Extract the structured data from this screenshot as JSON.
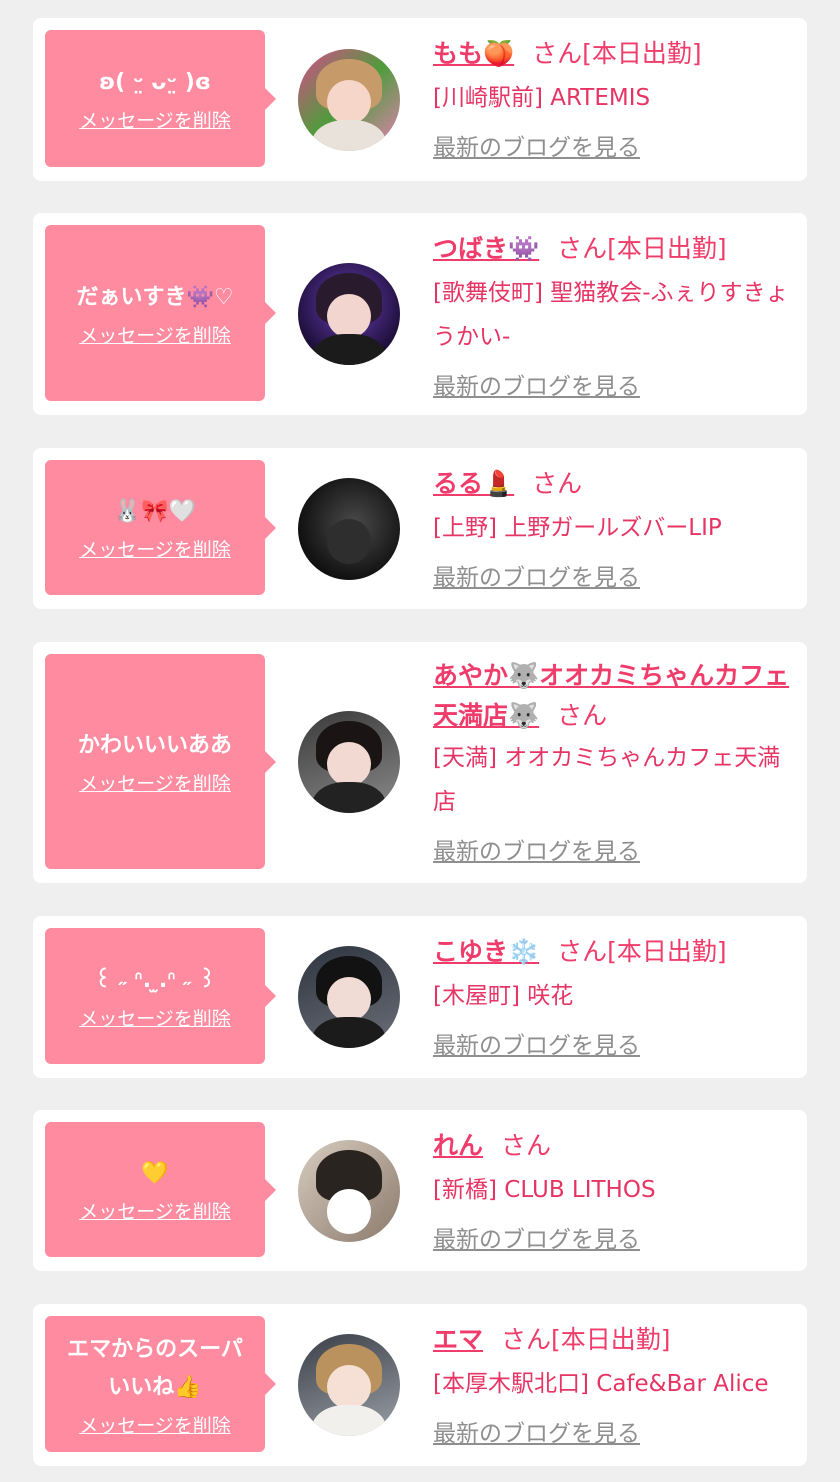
{
  "colors": {
    "accent": "#fe8ba0",
    "name": "#ef3c6b",
    "shop": "#e63565",
    "link_gray": "#8f8f8f",
    "page_bg": "#efefef"
  },
  "delete_label": "メッセージを削除",
  "blog_label": "最新のブログを見る",
  "items": [
    {
      "message": "ʚ(  ᵕ̤ ᴗᵕ̤ )ɞ",
      "name": "もも🍑",
      "suffix": "さん[本日出勤]",
      "shop": "[川崎駅前] ARTEMIS"
    },
    {
      "message": "だぁいすき👾♡",
      "name": "つばき👾",
      "suffix": "さん[本日出勤]",
      "shop": "[歌舞伎町] 聖猫教会-ふぇりすきょうかい-"
    },
    {
      "message": "🐰🎀🤍",
      "name": "るる💄",
      "suffix": "さん",
      "shop": "[上野] 上野ガールズバーLIP"
    },
    {
      "message": "かわいいいああ",
      "name": "あやか🐺オオカミちゃんカフェ天満店🐺",
      "suffix": "さん",
      "shop": "[天満] オオカミちゃんカフェ天満店"
    },
    {
      "message": "꒰ ˶ ᐢ. ̫.ᐢ ˶ ꒱",
      "name": "こゆき❄️",
      "suffix": "さん[本日出勤]",
      "shop": "[木屋町] 咲花"
    },
    {
      "message": "💛",
      "name": "れん",
      "suffix": "さん",
      "shop": "[新橋] CLUB LITHOS"
    },
    {
      "message": "エマからのスーパいいね👍",
      "name": "エマ",
      "suffix": "さん[本日出勤]",
      "shop": "[本厚木駅北口] Cafe&Bar Alice"
    }
  ]
}
